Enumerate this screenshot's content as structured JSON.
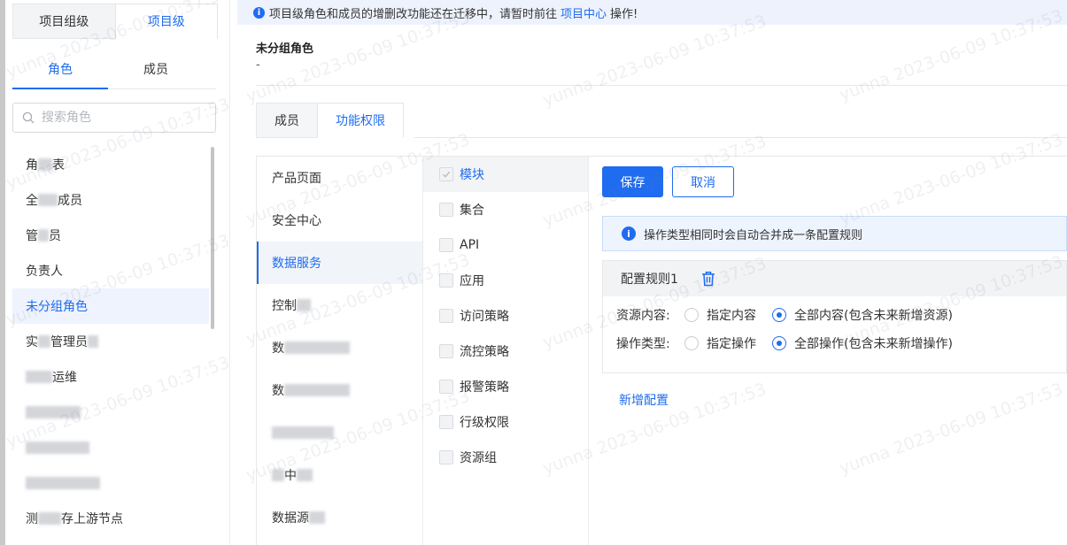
{
  "notice": {
    "text_before": "项目级角色和成员的增删改功能还在迁移中，请暂时前往",
    "link": "项目中心",
    "text_after": "操作!"
  },
  "level_tabs": [
    "项目组级",
    "项目级"
  ],
  "sub_tabs": [
    "角色",
    "成员"
  ],
  "search": {
    "placeholder": "搜索角色"
  },
  "roles": [
    {
      "prefix": "角",
      "suffix": "表"
    },
    {
      "prefix": "全",
      "suffix": "成员"
    },
    {
      "prefix": "管",
      "suffix": "员"
    },
    {
      "prefix": "负责人",
      "suffix": ""
    },
    {
      "prefix": "未分组角色",
      "suffix": ""
    },
    {
      "prefix": "实",
      "suffix": "管理员"
    },
    {
      "prefix": "",
      "suffix": "运维"
    },
    {
      "prefix": "",
      "suffix": ""
    },
    {
      "prefix": "",
      "suffix": ""
    },
    {
      "prefix": "",
      "suffix": ""
    },
    {
      "prefix": "测",
      "suffix": "存上游节点"
    }
  ],
  "group": {
    "title": "未分组角色",
    "desc": "-"
  },
  "main_tabs": [
    "成员",
    "功能权限"
  ],
  "products": [
    {
      "label": "产品页面"
    },
    {
      "label": "安全中心"
    },
    {
      "label": "数据服务"
    },
    {
      "label": "控制"
    },
    {
      "label": "数"
    },
    {
      "label": "数"
    },
    {
      "label": ""
    },
    {
      "label": "中"
    },
    {
      "label": "数据源"
    }
  ],
  "modules": [
    "模块",
    "集合",
    "API",
    "应用",
    "访问策略",
    "流控策略",
    "报警策略",
    "行级权限",
    "资源组"
  ],
  "actions": {
    "save": "保存",
    "cancel": "取消"
  },
  "tip": "操作类型相同时会自动合并成一条配置规则",
  "rule": {
    "title": "配置规则1",
    "resource_label": "资源内容:",
    "resource_options": [
      "指定内容",
      "全部内容(包含未来新增资源)"
    ],
    "operation_label": "操作类型:",
    "operation_options": [
      "指定操作",
      "全部操作(包含未来新增操作)"
    ]
  },
  "add_config": "新增配置",
  "watermark": "yunna 2023-06-09 10:37:53",
  "colors": {
    "primary": "#1f6cf0",
    "notice_bg": "#edf2fc",
    "tip_bg": "#eef4fe"
  }
}
